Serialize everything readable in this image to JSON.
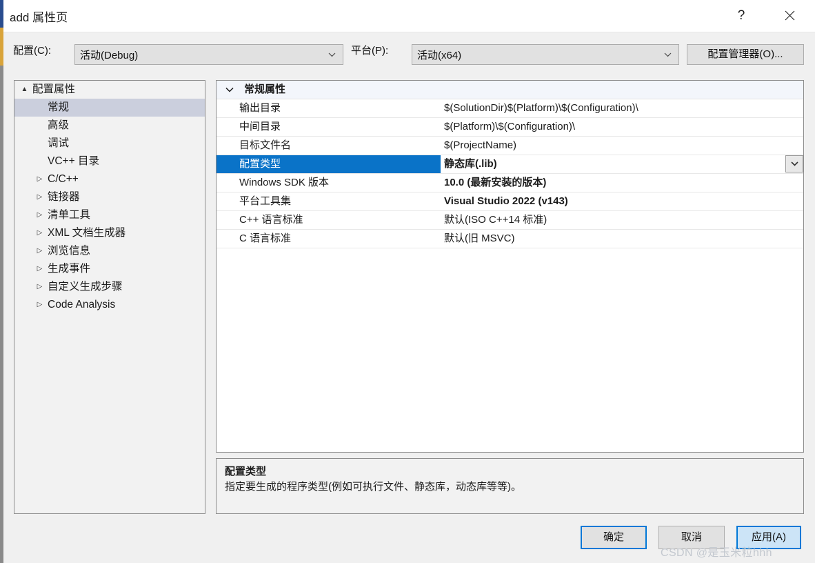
{
  "window": {
    "title": "add 属性页",
    "help_icon": "question-mark-icon",
    "close_icon": "close-icon"
  },
  "toolbar": {
    "config_label": "配置(C):",
    "config_value": "活动(Debug)",
    "platform_label": "平台(P):",
    "platform_value": "活动(x64)",
    "config_manager_label": "配置管理器(O)..."
  },
  "sidebar": {
    "items": [
      {
        "label": "配置属性",
        "level": 0,
        "twisty": "▲",
        "selected": false
      },
      {
        "label": "常规",
        "level": 1,
        "twisty": "",
        "selected": true
      },
      {
        "label": "高级",
        "level": 1,
        "twisty": "",
        "selected": false
      },
      {
        "label": "调试",
        "level": 1,
        "twisty": "",
        "selected": false
      },
      {
        "label": "VC++ 目录",
        "level": 1,
        "twisty": "",
        "selected": false
      },
      {
        "label": "C/C++",
        "level": 1,
        "twisty": "▷",
        "selected": false
      },
      {
        "label": "链接器",
        "level": 1,
        "twisty": "▷",
        "selected": false
      },
      {
        "label": "清单工具",
        "level": 1,
        "twisty": "▷",
        "selected": false
      },
      {
        "label": "XML 文档生成器",
        "level": 1,
        "twisty": "▷",
        "selected": false
      },
      {
        "label": "浏览信息",
        "level": 1,
        "twisty": "▷",
        "selected": false
      },
      {
        "label": "生成事件",
        "level": 1,
        "twisty": "▷",
        "selected": false
      },
      {
        "label": "自定义生成步骤",
        "level": 1,
        "twisty": "▷",
        "selected": false
      },
      {
        "label": "Code Analysis",
        "level": 1,
        "twisty": "▷",
        "selected": false
      }
    ]
  },
  "grid": {
    "header": "常规属性",
    "header_chevron": "chevron-down-icon",
    "rows": [
      {
        "name": "输出目录",
        "value": "$(SolutionDir)$(Platform)\\$(Configuration)\\",
        "bold": false,
        "selected": false
      },
      {
        "name": "中间目录",
        "value": "$(Platform)\\$(Configuration)\\",
        "bold": false,
        "selected": false
      },
      {
        "name": "目标文件名",
        "value": "$(ProjectName)",
        "bold": false,
        "selected": false
      },
      {
        "name": "配置类型",
        "value": "静态库(.lib)",
        "bold": true,
        "selected": true
      },
      {
        "name": "Windows SDK 版本",
        "value": "10.0 (最新安装的版本)",
        "bold": true,
        "selected": false
      },
      {
        "name": "平台工具集",
        "value": "Visual Studio 2022 (v143)",
        "bold": true,
        "selected": false
      },
      {
        "name": "C++ 语言标准",
        "value": "默认(ISO C++14 标准)",
        "bold": false,
        "selected": false
      },
      {
        "name": "C 语言标准",
        "value": "默认(旧 MSVC)",
        "bold": false,
        "selected": false
      }
    ]
  },
  "description": {
    "title": "配置类型",
    "body": "指定要生成的程序类型(例如可执行文件、静态库，动态库等等)。"
  },
  "footer": {
    "ok_label": "确定",
    "cancel_label": "取消",
    "apply_label": "应用(A)"
  },
  "watermark": {
    "text": "CSDN @是玉米粒hhh"
  },
  "colors": {
    "accent_blue": "#0078d7",
    "selection_blue": "#0a73c8",
    "tree_selection": "#cbcfdd",
    "panel_bg": "#f0f0f0",
    "apply_fill": "#cce4f7"
  }
}
